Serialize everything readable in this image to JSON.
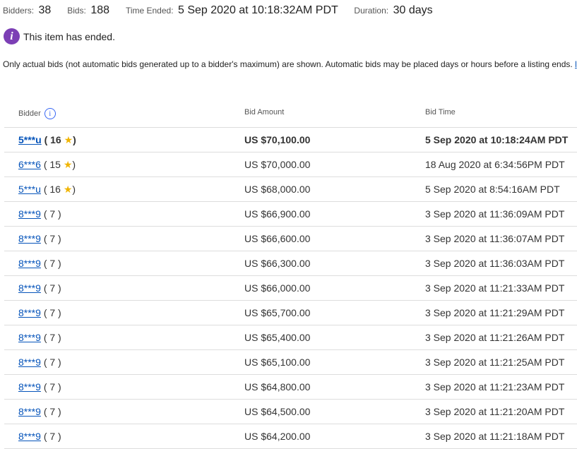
{
  "summary": {
    "bidders_label": "Bidders:",
    "bidders_value": "38",
    "bids_label": "Bids:",
    "bids_value": "188",
    "time_ended_label": "Time Ended:",
    "time_ended_value": "5 Sep 2020 at 10:18:32AM PDT",
    "duration_label": "Duration:",
    "duration_value": "30 days"
  },
  "notice": {
    "icon": "info-icon",
    "text": "This item has ended."
  },
  "note": {
    "text": "Only actual bids (not automatic bids generated up to a bidder's maximum) are shown. Automatic bids may be placed days or hours before a listing ends.",
    "link_fragment": "l"
  },
  "table": {
    "headers": {
      "bidder": "Bidder",
      "bid_amount": "Bid Amount",
      "bid_time": "Bid Time"
    },
    "rows": [
      {
        "bidder": "5***u",
        "score": "( 16",
        "star": true,
        "score_close": ")",
        "amount": "US $70,100.00",
        "time": "5 Sep 2020 at 10:18:24AM PDT",
        "winner": true
      },
      {
        "bidder": "6***6",
        "score": "( 15",
        "star": true,
        "score_close": ")",
        "amount": "US $70,000.00",
        "time": "18 Aug 2020 at 6:34:56PM PDT",
        "winner": false
      },
      {
        "bidder": "5***u",
        "score": "( 16",
        "star": true,
        "score_close": ")",
        "amount": "US $68,000.00",
        "time": "5 Sep 2020 at 8:54:16AM PDT",
        "winner": false
      },
      {
        "bidder": "8***9",
        "score": "( 7 )",
        "star": false,
        "score_close": "",
        "amount": "US $66,900.00",
        "time": "3 Sep 2020 at 11:36:09AM PDT",
        "winner": false
      },
      {
        "bidder": "8***9",
        "score": "( 7 )",
        "star": false,
        "score_close": "",
        "amount": "US $66,600.00",
        "time": "3 Sep 2020 at 11:36:07AM PDT",
        "winner": false
      },
      {
        "bidder": "8***9",
        "score": "( 7 )",
        "star": false,
        "score_close": "",
        "amount": "US $66,300.00",
        "time": "3 Sep 2020 at 11:36:03AM PDT",
        "winner": false
      },
      {
        "bidder": "8***9",
        "score": "( 7 )",
        "star": false,
        "score_close": "",
        "amount": "US $66,000.00",
        "time": "3 Sep 2020 at 11:21:33AM PDT",
        "winner": false
      },
      {
        "bidder": "8***9",
        "score": "( 7 )",
        "star": false,
        "score_close": "",
        "amount": "US $65,700.00",
        "time": "3 Sep 2020 at 11:21:29AM PDT",
        "winner": false
      },
      {
        "bidder": "8***9",
        "score": "( 7 )",
        "star": false,
        "score_close": "",
        "amount": "US $65,400.00",
        "time": "3 Sep 2020 at 11:21:26AM PDT",
        "winner": false
      },
      {
        "bidder": "8***9",
        "score": "( 7 )",
        "star": false,
        "score_close": "",
        "amount": "US $65,100.00",
        "time": "3 Sep 2020 at 11:21:25AM PDT",
        "winner": false
      },
      {
        "bidder": "8***9",
        "score": "( 7 )",
        "star": false,
        "score_close": "",
        "amount": "US $64,800.00",
        "time": "3 Sep 2020 at 11:21:23AM PDT",
        "winner": false
      },
      {
        "bidder": "8***9",
        "score": "( 7 )",
        "star": false,
        "score_close": "",
        "amount": "US $64,500.00",
        "time": "3 Sep 2020 at 11:21:20AM PDT",
        "winner": false
      },
      {
        "bidder": "8***9",
        "score": "( 7 )",
        "star": false,
        "score_close": "",
        "amount": "US $64,200.00",
        "time": "3 Sep 2020 at 11:21:18AM PDT",
        "winner": false
      }
    ]
  },
  "colors": {
    "link": "#0654ba",
    "info_icon_bg": "#7c3fb5",
    "star": "#f0b400",
    "divider": "#dddddd"
  }
}
